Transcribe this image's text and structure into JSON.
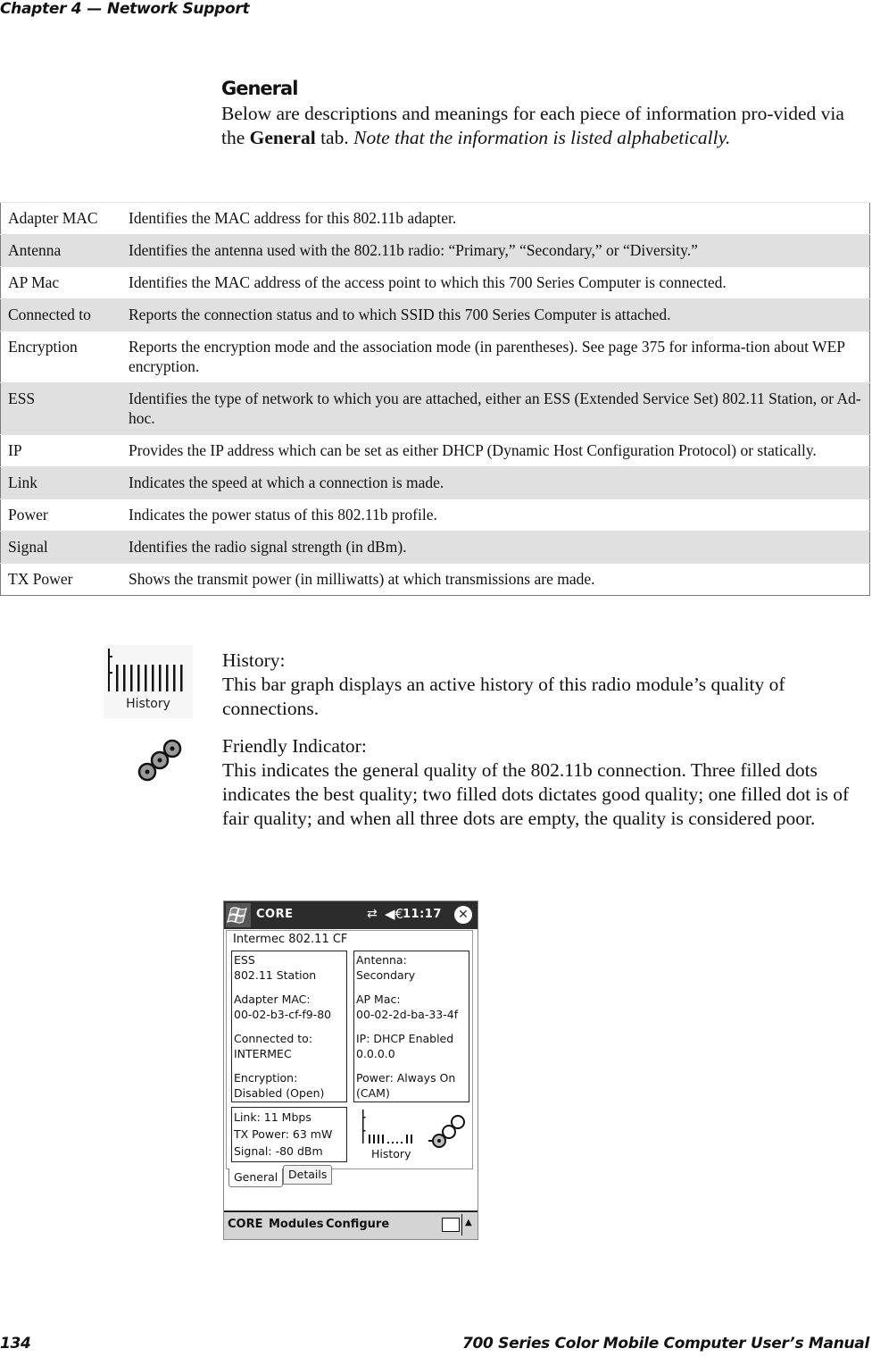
{
  "running_head": {
    "chapter": "Chapter 4",
    "separator": "—",
    "title": "Network Support"
  },
  "section": {
    "heading": "General",
    "intro_prefix": "Below are descriptions and meanings for each piece of information pro-vided via the ",
    "intro_bold": "General",
    "intro_mid": " tab. ",
    "intro_italic": "Note that the information is listed alphabetically."
  },
  "definitions": [
    {
      "term": "Adapter MAC",
      "desc": "Identifies the MAC address for this 802.11b adapter."
    },
    {
      "term": "Antenna",
      "desc": "Identifies the antenna used with the 802.11b radio: “Primary,” “Secondary,” or “Diversity.”"
    },
    {
      "term": "AP Mac",
      "desc": "Identifies the MAC address of the access point to which this 700 Series Computer is connected."
    },
    {
      "term": "Connected to",
      "desc": "Reports the connection status and to which SSID this 700 Series Computer is attached."
    },
    {
      "term": "Encryption",
      "desc": "Reports the encryption mode and the association mode (in parentheses). See page 375 for informa-tion about WEP encryption."
    },
    {
      "term": "ESS",
      "desc": "Identifies the type of network to which you are attached, either an ESS (Extended Service Set) 802.11 Station, or Ad-hoc."
    },
    {
      "term": "IP",
      "desc": "Provides the IP address which can be set as either DHCP (Dynamic Host Configuration Protocol) or statically."
    },
    {
      "term": "Link",
      "desc": "Indicates the speed at which a connection is made."
    },
    {
      "term": "Power",
      "desc": "Indicates the power status of this 802.11b profile."
    },
    {
      "term": "Signal",
      "desc": "Identifies the radio signal strength (in dBm)."
    },
    {
      "term": "TX Power",
      "desc": "Shows the transmit power (in milliwatts) at which transmissions are made."
    }
  ],
  "icons": {
    "history": {
      "icon_label": "History",
      "title": "History:",
      "text": "This bar graph displays an active history of this radio module’s quality of connections."
    },
    "friendly": {
      "title": "Friendly Indicator:",
      "text": "This indicates the general quality of the 802.11b connection. Three filled dots indicates the best quality; two filled dots dictates good quality; one filled dot is of fair quality; and when all three dots are empty, the quality is considered poor."
    }
  },
  "device": {
    "titlebar": {
      "app": "CORE",
      "time": "11:17"
    },
    "panel_title": "Intermec 802.11 CF",
    "left": {
      "ess_label": "ESS",
      "ess_value": "802.11 Station",
      "mac_label": "Adapter MAC:",
      "mac_value": "00-02-b3-cf-f9-80",
      "conn_label": "Connected to:",
      "conn_value": "INTERMEC",
      "enc_label": "Encryption:",
      "enc_value": "Disabled (Open)"
    },
    "right": {
      "ant_label": "Antenna:",
      "ant_value": "Secondary",
      "ap_label": "AP Mac:",
      "ap_value": "00-02-2d-ba-33-4f",
      "ip_label": "IP: DHCP Enabled",
      "ip_value": "0.0.0.0",
      "power_label": "Power: Always On",
      "power_value": "(CAM)"
    },
    "stats": {
      "link": "Link: 11 Mbps",
      "tx": "TX Power: 63 mW",
      "signal": "Signal: -80 dBm"
    },
    "history_label": "History",
    "friendly_filled_dots": 1,
    "tabs": [
      "General",
      "Details"
    ],
    "menu": {
      "core": "CORE",
      "modules": "Modules",
      "configure": "Configure"
    }
  },
  "footer": {
    "page": "134",
    "manual": "700 Series Color Mobile Computer User’s Manual"
  }
}
